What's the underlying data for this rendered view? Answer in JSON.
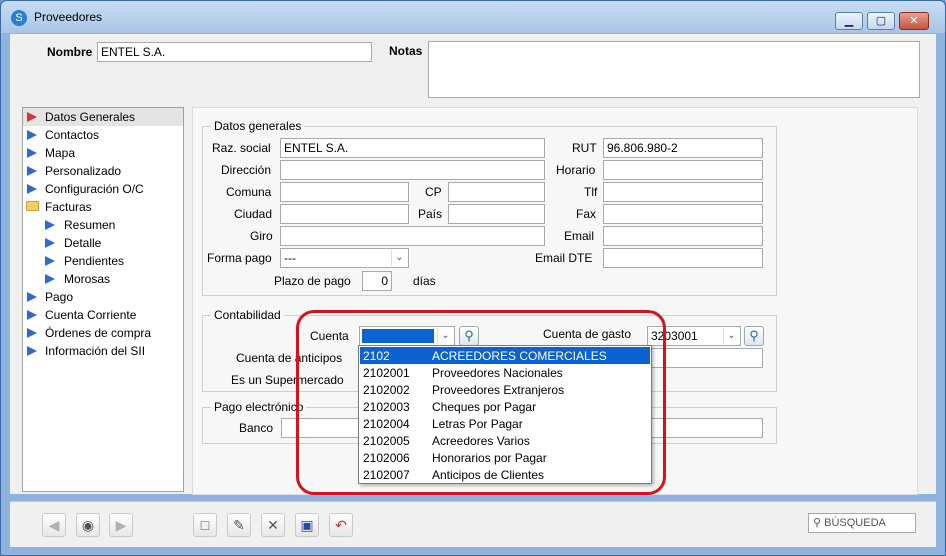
{
  "window": {
    "title": "Proveedores"
  },
  "header": {
    "nombre_label": "Nombre",
    "nombre_value": "ENTEL S.A.",
    "notas_label": "Notas",
    "notas_value": ""
  },
  "sidebar": {
    "items": [
      {
        "label": "Datos Generales"
      },
      {
        "label": "Contactos"
      },
      {
        "label": "Mapa"
      },
      {
        "label": "Personalizado"
      },
      {
        "label": "Configuración O/C"
      },
      {
        "label": "Facturas"
      },
      {
        "label": "Resumen"
      },
      {
        "label": "Detalle"
      },
      {
        "label": "Pendientes"
      },
      {
        "label": "Morosas"
      },
      {
        "label": "Pago"
      },
      {
        "label": "Cuenta Corriente"
      },
      {
        "label": "Órdenes de compra"
      },
      {
        "label": "Información del SII"
      }
    ]
  },
  "datos_generales": {
    "group_title": "Datos generales",
    "razon_social_label": "Raz. social",
    "razon_social_value": "ENTEL S.A.",
    "rut_label": "RUT",
    "rut_value": "96.806.980-2",
    "direccion_label": "Dirección",
    "horario_label": "Horario",
    "comuna_label": "Comuna",
    "cp_label": "CP",
    "tlf_label": "Tlf",
    "ciudad_label": "Ciudad",
    "pais_label": "País",
    "fax_label": "Fax",
    "giro_label": "Giro",
    "email_label": "Email",
    "forma_pago_label": "Forma pago",
    "forma_pago_value": "---",
    "email_dte_label": "Email DTE",
    "plazo_pago_label": "Plazo de pago",
    "plazo_pago_value": "0",
    "dias_label": "días"
  },
  "contabilidad": {
    "group_title": "Contabilidad",
    "cuenta_label": "Cuenta",
    "cuenta_gasto_label": "Cuenta de gasto",
    "cuenta_gasto_value": "3203001",
    "cuenta_anticipos_label": "Cuenta de anticipos",
    "supermercado_label": "Es un Supermercado",
    "dropdown": [
      {
        "code": "2102",
        "name": "ACREEDORES COMERCIALES"
      },
      {
        "code": "2102001",
        "name": "Proveedores Nacionales"
      },
      {
        "code": "2102002",
        "name": "Proveedores Extranjeros"
      },
      {
        "code": "2102003",
        "name": "Cheques por Pagar"
      },
      {
        "code": "2102004",
        "name": "Letras Por Pagar"
      },
      {
        "code": "2102005",
        "name": "Acreedores Varios"
      },
      {
        "code": "2102006",
        "name": "Honorarios por Pagar"
      },
      {
        "code": "2102007",
        "name": "Anticipos de Clientes"
      }
    ]
  },
  "pago_electronico": {
    "group_title": "Pago electrónico",
    "banco_label": "Banco"
  },
  "toolbar": {
    "search_placeholder": "BÚSQUEDA"
  },
  "colors": {
    "accent": "#0a63d0",
    "highlight": "#d4141c"
  }
}
